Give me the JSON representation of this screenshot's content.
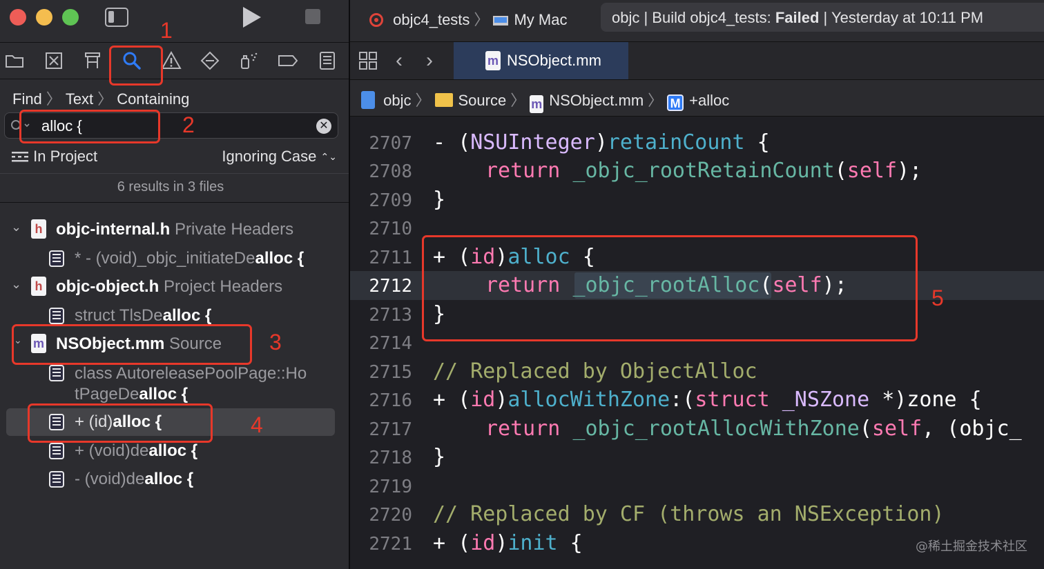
{
  "window": {
    "scheme": "objc4_tests",
    "destination": "My Mac",
    "status_prefix": "objc | Build objc4_tests: ",
    "status_result": "Failed",
    "status_suffix": " | Yesterday at 10:11 PM"
  },
  "navigator": {
    "find_crumbs": [
      "Find",
      "Text",
      "Containing"
    ],
    "search_value": "alloc {",
    "scope": "In Project",
    "case_mode": "Ignoring Case",
    "results_summary": "6 results in 3 files",
    "groups": [
      {
        "file": "objc-internal.h",
        "kind": "Private Headers",
        "icon": "h",
        "results": [
          {
            "prefix": "* - (void)_objc_initiateDe",
            "match": "alloc {"
          }
        ]
      },
      {
        "file": "objc-object.h",
        "kind": "Project Headers",
        "icon": "h",
        "results": [
          {
            "prefix": "struct TlsDe",
            "match": "alloc {"
          }
        ]
      },
      {
        "file": "NSObject.mm",
        "kind": "Source",
        "icon": "m",
        "results": [
          {
            "prefix": "class AutoreleasePoolPage::Ho",
            "prefix2": "tPageDe",
            "match": "alloc {"
          },
          {
            "prefix": "+ (id)",
            "match": "alloc {"
          },
          {
            "prefix": "+ (void)de",
            "match": "alloc {"
          },
          {
            "prefix": "- (void)de",
            "match": "alloc {"
          }
        ]
      }
    ],
    "icon_letters": {
      "h": "h",
      "m": "m"
    }
  },
  "annotations": [
    "1",
    "2",
    "3",
    "4",
    "5"
  ],
  "editor": {
    "tab_label": "NSObject.mm",
    "tab_icon": "m",
    "jump_bar": [
      "objc",
      "Source",
      "NSObject.mm",
      "+alloc"
    ],
    "jump_method_badge": "M",
    "current_line": "2712",
    "lines": [
      {
        "num": "2707"
      },
      {
        "num": "2708"
      },
      {
        "num": "2709"
      },
      {
        "num": "2710"
      },
      {
        "num": "2711"
      },
      {
        "num": "2712"
      },
      {
        "num": "2713"
      },
      {
        "num": "2714"
      },
      {
        "num": "2715"
      },
      {
        "num": "2716"
      },
      {
        "num": "2717"
      },
      {
        "num": "2718"
      },
      {
        "num": "2719"
      },
      {
        "num": "2720"
      },
      {
        "num": "2721"
      }
    ],
    "code": {
      "minus": "- ",
      "paren_open": "(",
      "nsuinteger": "NSUInteger",
      "paren_close": ")",
      "retainCount": "retainCount",
      "brace_open": " {",
      "ret": "return",
      "rootRetainCount": "_objc_rootRetainCount",
      "self_call": "(self);",
      "self_kw": "self",
      "brace_close": "}",
      "plus": "+ ",
      "id": "id",
      "alloc": "alloc",
      "rootAlloc": "_objc_rootAlloc",
      "comment1": "// Replaced by ObjectAlloc",
      "allocWithZone": "allocWithZone",
      "colon_paren": ":(",
      "struct_kw": "struct",
      "nszone": " _NSZone ",
      "zone_rest": "*)zone {",
      "rootAllocWithZone": "_objc_rootAllocWithZone",
      "awz_rest": ", (objc_",
      "comment2": "// Replaced by CF (throws an NSException)",
      "init": "init"
    }
  },
  "watermark": "@稀土掘金技术社区",
  "colors": {
    "accent": "#2f7bf6",
    "annotation": "#e7382a",
    "close": "#ee5d57",
    "minimize": "#f4bd4f",
    "zoom": "#5fc454"
  }
}
